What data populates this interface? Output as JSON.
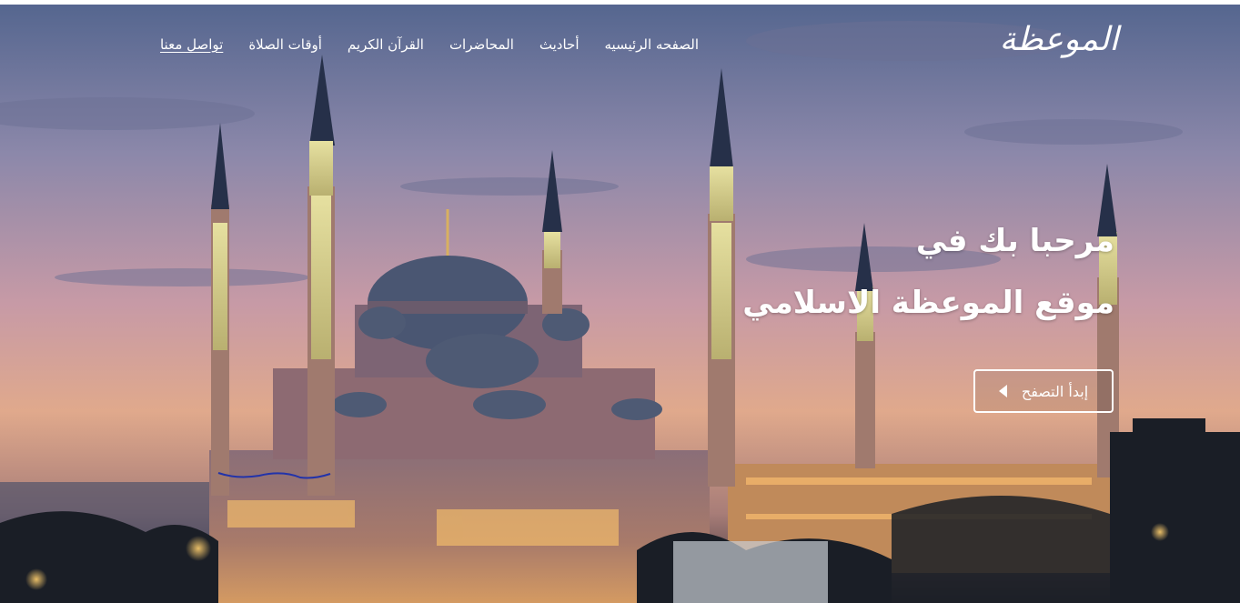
{
  "brand": {
    "logo_text": "الموعظة"
  },
  "nav": {
    "items": [
      {
        "label": "الصفحه الرئيسيه"
      },
      {
        "label": "أحاديث"
      },
      {
        "label": "المحاضرات"
      },
      {
        "label": "القرآن الكريم"
      },
      {
        "label": "أوقات الصلاة"
      },
      {
        "label": "تواصل معنا"
      }
    ]
  },
  "hero": {
    "line1": "مرحبا بك في",
    "line2": "موقع الموعظة الاسلامي",
    "cta_label": "إبدأ التصفح",
    "cta_icon": "caret-left-icon",
    "background": "blue-mosque-sunset-photo"
  },
  "colors": {
    "text": "#ffffff",
    "sky_top": "#5f6f9a",
    "sky_mid": "#c8a0b0",
    "sky_low": "#e8b07e"
  }
}
